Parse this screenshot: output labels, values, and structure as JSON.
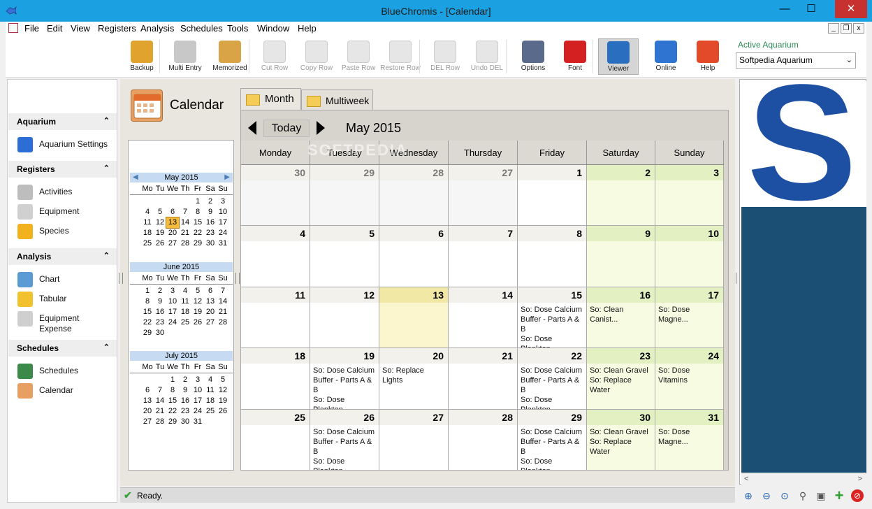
{
  "window": {
    "title": "BlueChromis - [Calendar]"
  },
  "menu": [
    "File",
    "Edit",
    "View",
    "Registers",
    "Analysis",
    "Schedules",
    "Tools",
    "Window",
    "Help"
  ],
  "toolbar": [
    {
      "label": "Backup",
      "icon": "usb-drive-icon",
      "enabled": true,
      "color": "#e0a32e"
    },
    {
      "label": "Multi Entry",
      "icon": "gears-icon",
      "enabled": true,
      "color": "#c8c8c8"
    },
    {
      "label": "Memorized",
      "icon": "notepad-icon",
      "enabled": true,
      "color": "#d9a446"
    },
    {
      "label": "Cut Row",
      "icon": "cut-row-icon",
      "enabled": false
    },
    {
      "label": "Copy Row",
      "icon": "copy-row-icon",
      "enabled": false
    },
    {
      "label": "Paste Row",
      "icon": "paste-row-icon",
      "enabled": false
    },
    {
      "label": "Restore Row",
      "icon": "restore-row-icon",
      "enabled": false
    },
    {
      "label": "DEL Row",
      "icon": "delete-row-icon",
      "enabled": false
    },
    {
      "label": "Undo DEL",
      "icon": "undo-delete-icon",
      "enabled": false
    },
    {
      "label": "Options",
      "icon": "gauge-icon",
      "enabled": true,
      "color": "#5a6a8a"
    },
    {
      "label": "Font",
      "icon": "font-icon",
      "enabled": true,
      "color": "#d42020"
    },
    {
      "label": "Viewer",
      "icon": "magnifier-icon",
      "enabled": true,
      "active": true,
      "color": "#2a6fbf"
    },
    {
      "label": "Online",
      "icon": "globe-icon",
      "enabled": true,
      "color": "#2f74d0"
    },
    {
      "label": "Help",
      "icon": "lifebuoy-icon",
      "enabled": true,
      "color": "#e24a2a"
    }
  ],
  "active_aquarium": {
    "label": "Active Aquarium",
    "value": "Softpedia Aquarium"
  },
  "sidebar": {
    "groups": [
      {
        "title": "Aquarium",
        "items": [
          {
            "label": "Aquarium Settings",
            "icon": "fish-icon"
          }
        ]
      },
      {
        "title": "Registers",
        "items": [
          {
            "label": "Activities",
            "icon": "gear-icon"
          },
          {
            "label": "Equipment",
            "icon": "pump-icon"
          },
          {
            "label": "Species",
            "icon": "species-fish-icon"
          }
        ]
      },
      {
        "title": "Analysis",
        "items": [
          {
            "label": "Chart",
            "icon": "chart-icon"
          },
          {
            "label": "Tabular",
            "icon": "table-icon"
          },
          {
            "label": "Equipment Expense",
            "icon": "equipment-expense-icon"
          }
        ]
      },
      {
        "title": "Schedules",
        "items": [
          {
            "label": "Schedules",
            "icon": "schedule-icon"
          },
          {
            "label": "Calendar",
            "icon": "calendar-icon"
          }
        ]
      }
    ]
  },
  "calendar": {
    "heading": "Calendar",
    "tabs": [
      "Month",
      "Multiweek"
    ],
    "today_label": "Today",
    "month_title": "May 2015",
    "watermark": "SOFTPEDIA",
    "day_names": [
      "Monday",
      "Tuesday",
      "Wednesday",
      "Thursday",
      "Friday",
      "Saturday",
      "Sunday"
    ],
    "weeks": [
      [
        {
          "d": "30",
          "prev": true
        },
        {
          "d": "29",
          "prev": true
        },
        {
          "d": "28",
          "prev": true
        },
        {
          "d": "27",
          "prev": true
        },
        {
          "d": "1"
        },
        {
          "d": "2"
        },
        {
          "d": "3"
        }
      ],
      [
        {
          "d": "4"
        },
        {
          "d": "5"
        },
        {
          "d": "6"
        },
        {
          "d": "7"
        },
        {
          "d": "8"
        },
        {
          "d": "9"
        },
        {
          "d": "10"
        }
      ],
      [
        {
          "d": "11"
        },
        {
          "d": "12"
        },
        {
          "d": "13",
          "today": true
        },
        {
          "d": "14"
        },
        {
          "d": "15",
          "ev": [
            "So: Dose Calcium Buffer - Parts A & B",
            "So: Dose Plankton"
          ]
        },
        {
          "d": "16",
          "ev": [
            "So: Clean Canist..."
          ]
        },
        {
          "d": "17",
          "ev": [
            "So: Dose Magne..."
          ]
        }
      ],
      [
        {
          "d": "18"
        },
        {
          "d": "19",
          "ev": [
            "So: Dose Calcium Buffer - Parts A & B",
            "So: Dose Plankton"
          ]
        },
        {
          "d": "20",
          "ev": [
            "So: Replace Lights"
          ]
        },
        {
          "d": "21"
        },
        {
          "d": "22",
          "ev": [
            "So: Dose Calcium Buffer - Parts A & B",
            "So: Dose Plankton"
          ]
        },
        {
          "d": "23",
          "ev": [
            "So: Clean Gravel",
            "So: Replace Water"
          ]
        },
        {
          "d": "24",
          "ev": [
            "So: Dose Vitamins"
          ]
        }
      ],
      [
        {
          "d": "25"
        },
        {
          "d": "26",
          "ev": [
            "So: Dose Calcium Buffer - Parts A & B",
            "So: Dose Plankton"
          ]
        },
        {
          "d": "27"
        },
        {
          "d": "28"
        },
        {
          "d": "29",
          "ev": [
            "So: Dose Calcium Buffer - Parts A & B",
            "So: Dose Plankton"
          ]
        },
        {
          "d": "30",
          "ev": [
            "So: Clean Gravel",
            "So: Replace Water"
          ]
        },
        {
          "d": "31",
          "ev": [
            "So: Dose Magne..."
          ]
        }
      ]
    ]
  },
  "mini_calendars": [
    {
      "title": "May 2015",
      "dow": [
        "Mo",
        "Tu",
        "We",
        "Th",
        "Fr",
        "Sa",
        "Su"
      ],
      "weeks": [
        [
          "",
          "",
          "",
          "",
          "1",
          "2",
          "3"
        ],
        [
          "4",
          "5",
          "6",
          "7",
          "8",
          "9",
          "10"
        ],
        [
          "11",
          "12",
          "13",
          "14",
          "15",
          "16",
          "17"
        ],
        [
          "18",
          "19",
          "20",
          "21",
          "22",
          "23",
          "24"
        ],
        [
          "25",
          "26",
          "27",
          "28",
          "29",
          "30",
          "31"
        ]
      ],
      "selected": "13"
    },
    {
      "title": "June 2015",
      "dow": [
        "Mo",
        "Tu",
        "We",
        "Th",
        "Fr",
        "Sa",
        "Su"
      ],
      "weeks": [
        [
          "1",
          "2",
          "3",
          "4",
          "5",
          "6",
          "7"
        ],
        [
          "8",
          "9",
          "10",
          "11",
          "12",
          "13",
          "14"
        ],
        [
          "15",
          "16",
          "17",
          "18",
          "19",
          "20",
          "21"
        ],
        [
          "22",
          "23",
          "24",
          "25",
          "26",
          "27",
          "28"
        ],
        [
          "29",
          "30",
          "",
          "",
          "",
          "",
          ""
        ]
      ]
    },
    {
      "title": "July 2015",
      "dow": [
        "Mo",
        "Tu",
        "We",
        "Th",
        "Fr",
        "Sa",
        "Su"
      ],
      "weeks": [
        [
          "",
          "",
          "1",
          "2",
          "3",
          "4",
          "5"
        ],
        [
          "6",
          "7",
          "8",
          "9",
          "10",
          "11",
          "12"
        ],
        [
          "13",
          "14",
          "15",
          "16",
          "17",
          "18",
          "19"
        ],
        [
          "20",
          "21",
          "22",
          "23",
          "24",
          "25",
          "26"
        ],
        [
          "27",
          "28",
          "29",
          "30",
          "31",
          "",
          ""
        ]
      ]
    }
  ],
  "status": {
    "text": "Ready."
  }
}
